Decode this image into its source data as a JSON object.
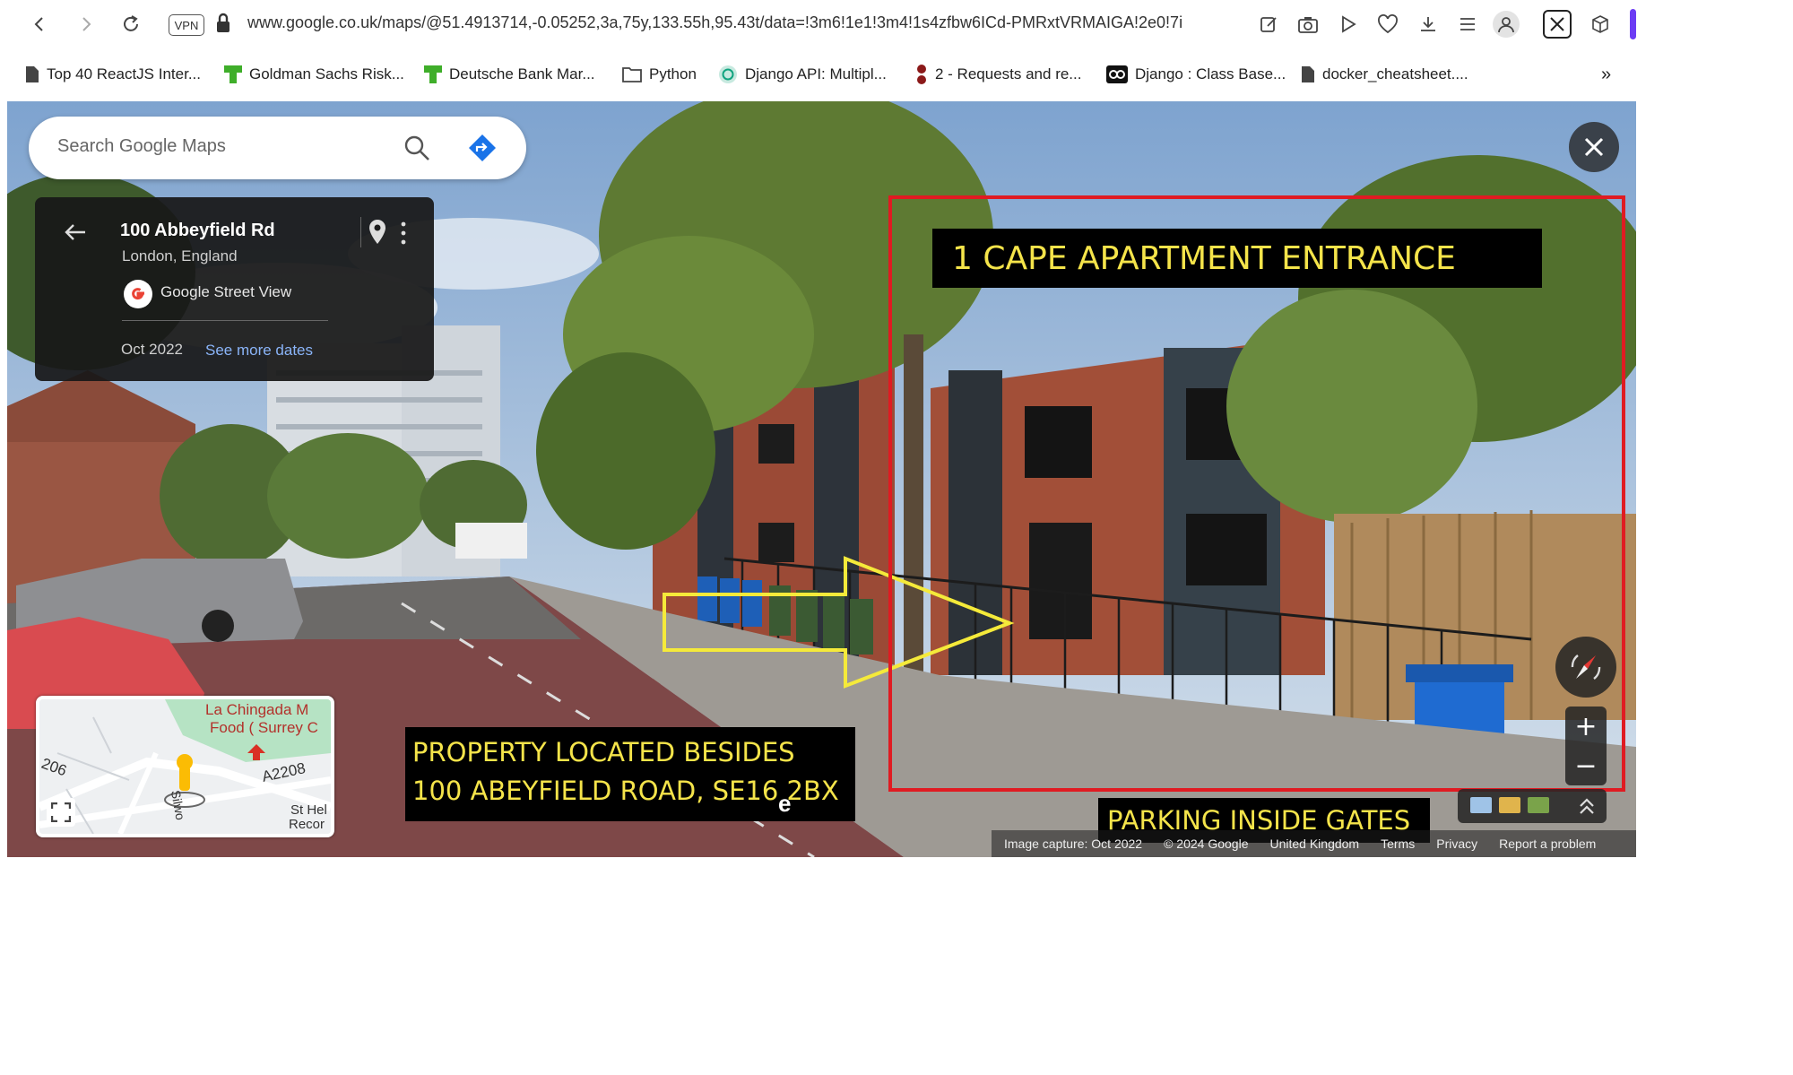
{
  "browser": {
    "url": "www.google.co.uk/maps/@51.4913714,-0.05252,3a,75y,133.55h,95.43t/data=!3m6!1e1!3m4!1s4zfbw6ICd-PMRxtVRMAIGA!2e0!7i",
    "vpn_label": "VPN",
    "bookmarks": [
      {
        "label": "Top 40 ReactJS Inter...",
        "icon": "document-icon",
        "color": "#444444"
      },
      {
        "label": "Goldman Sachs Risk...",
        "icon": "green-flag-icon",
        "color": "#3fae2a"
      },
      {
        "label": "Deutsche Bank Mar...",
        "icon": "green-flag-icon",
        "color": "#3fae2a"
      },
      {
        "label": "Python",
        "icon": "folder-icon",
        "color": "#444444"
      },
      {
        "label": "Django API: Multipl...",
        "icon": "chatgpt-icon",
        "color": "#10a37f"
      },
      {
        "label": "2 - Requests and re...",
        "icon": "red-icon",
        "color": "#8b1a1a"
      },
      {
        "label": "Django : Class Base...",
        "icon": "oo-icon",
        "color": "#111111"
      },
      {
        "label": "docker_cheatsheet....",
        "icon": "document-icon",
        "color": "#444444"
      }
    ],
    "more_label": "»"
  },
  "maps": {
    "search_placeholder": "Search Google Maps",
    "card": {
      "title": "100 Abbeyfield Rd",
      "subtitle": "London, England",
      "source": "Google Street View",
      "date": "Oct 2022",
      "link": "See more dates"
    },
    "minimap": {
      "poi_line1": "La Chingada M",
      "poi_line2": "Food ( Surrey C",
      "road_label": "A2208",
      "side_label": "206",
      "street_label": "Silwo",
      "place_label_1": "St Hel",
      "place_label_2": "Recor"
    },
    "footer": {
      "capture": "Image capture: Oct 2022",
      "copyright": "© 2024 Google",
      "country": "United Kingdom",
      "terms": "Terms",
      "privacy": "Privacy",
      "report": "Report a problem"
    },
    "watermark": "e"
  },
  "annotations": {
    "entrance_label": "1 CAPE APARTMENT ENTRANCE",
    "property_line1": "PROPERTY LOCATED BESIDES",
    "property_line2": "100 ABEYFIELD ROAD, SE16 2BX",
    "parking_label": "PARKING INSIDE GATES",
    "frame_color": "#e01b22",
    "label_text_color": "#f5e44a",
    "arrow_color": "#f5ea3a"
  }
}
